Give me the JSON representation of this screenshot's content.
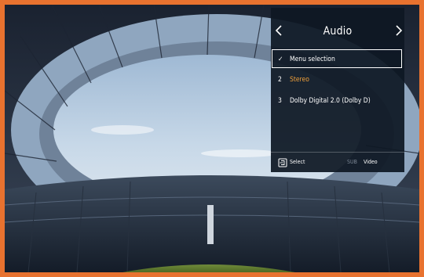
{
  "colors": {
    "frame": "#e8722f",
    "panel": "#0e1824",
    "accent_text": "#f0a03a"
  },
  "audio_menu": {
    "title": "Audio",
    "prev_icon": "chevron-left-icon",
    "next_icon": "chevron-right-icon",
    "items": [
      {
        "marker": "✓",
        "label": "Menu selection",
        "selected": true
      },
      {
        "marker": "2",
        "label": "Stereo",
        "highlighted": true
      },
      {
        "marker": "3",
        "label": "Dolby Digital 2.0 (Dolby D)"
      }
    ],
    "footer": {
      "select_icon": "select-icon",
      "select_label": "Select",
      "sub_label": "SUB",
      "video_label": "Video"
    }
  }
}
